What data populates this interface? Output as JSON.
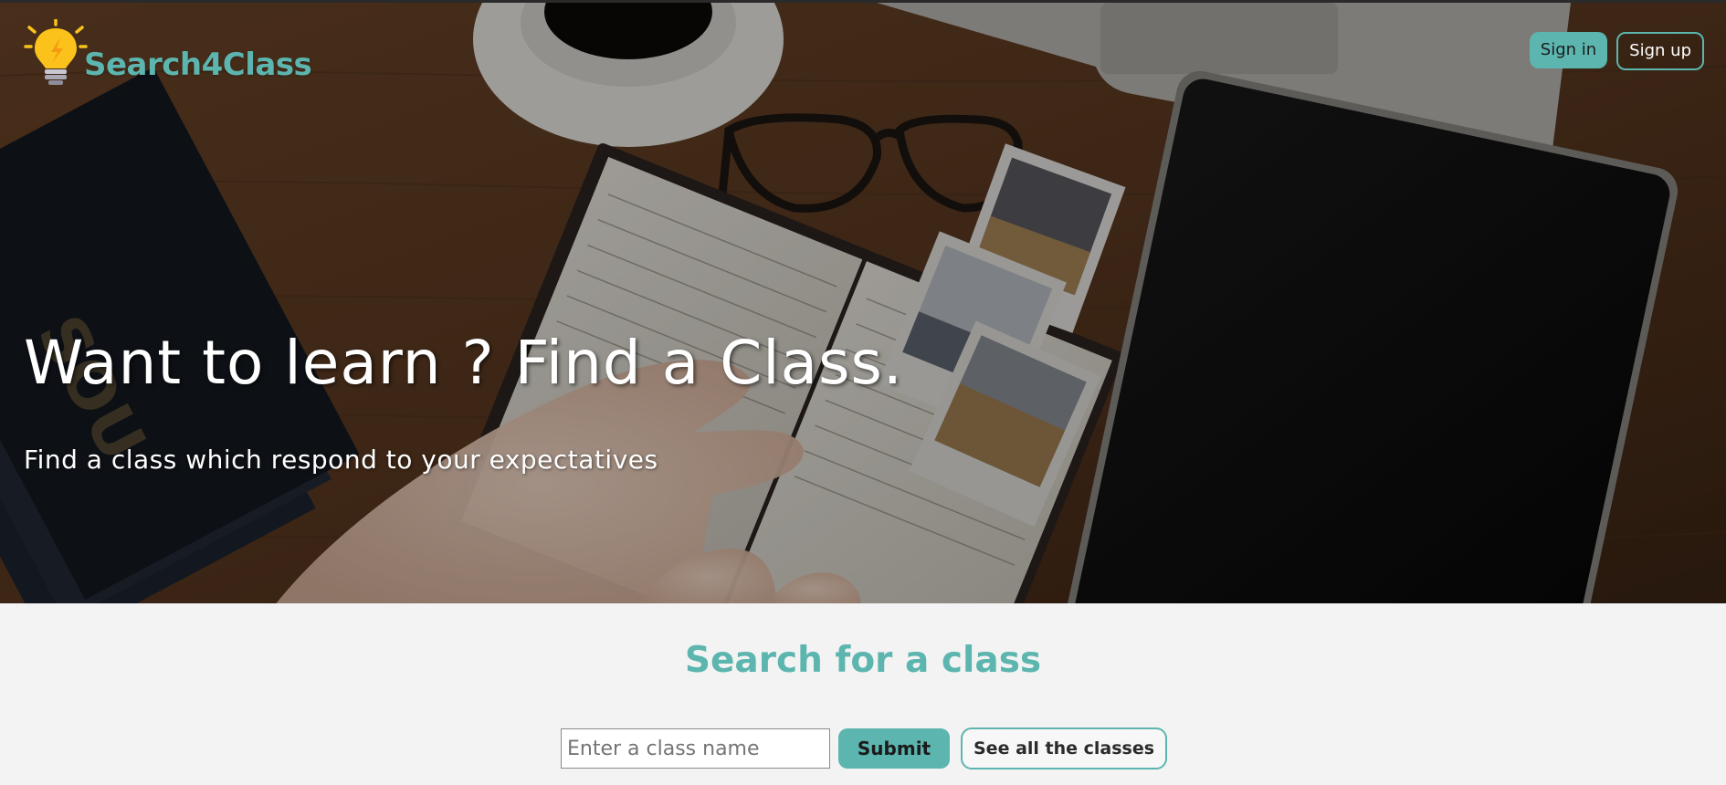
{
  "brand": {
    "name": "Search4Class",
    "logo_icon": "lightbulb-icon",
    "accent_color": "#5cb5ae"
  },
  "header": {
    "signin_label": "Sign in",
    "signup_label": "Sign up"
  },
  "hero": {
    "title": "Want to learn ? Find a Class.",
    "subtitle": "Find a class which respond to your expectatives"
  },
  "search": {
    "title": "Search for a class",
    "input_placeholder": "Enter a class name",
    "input_value": "",
    "submit_label": "Submit",
    "see_all_label": "See all the classes"
  }
}
